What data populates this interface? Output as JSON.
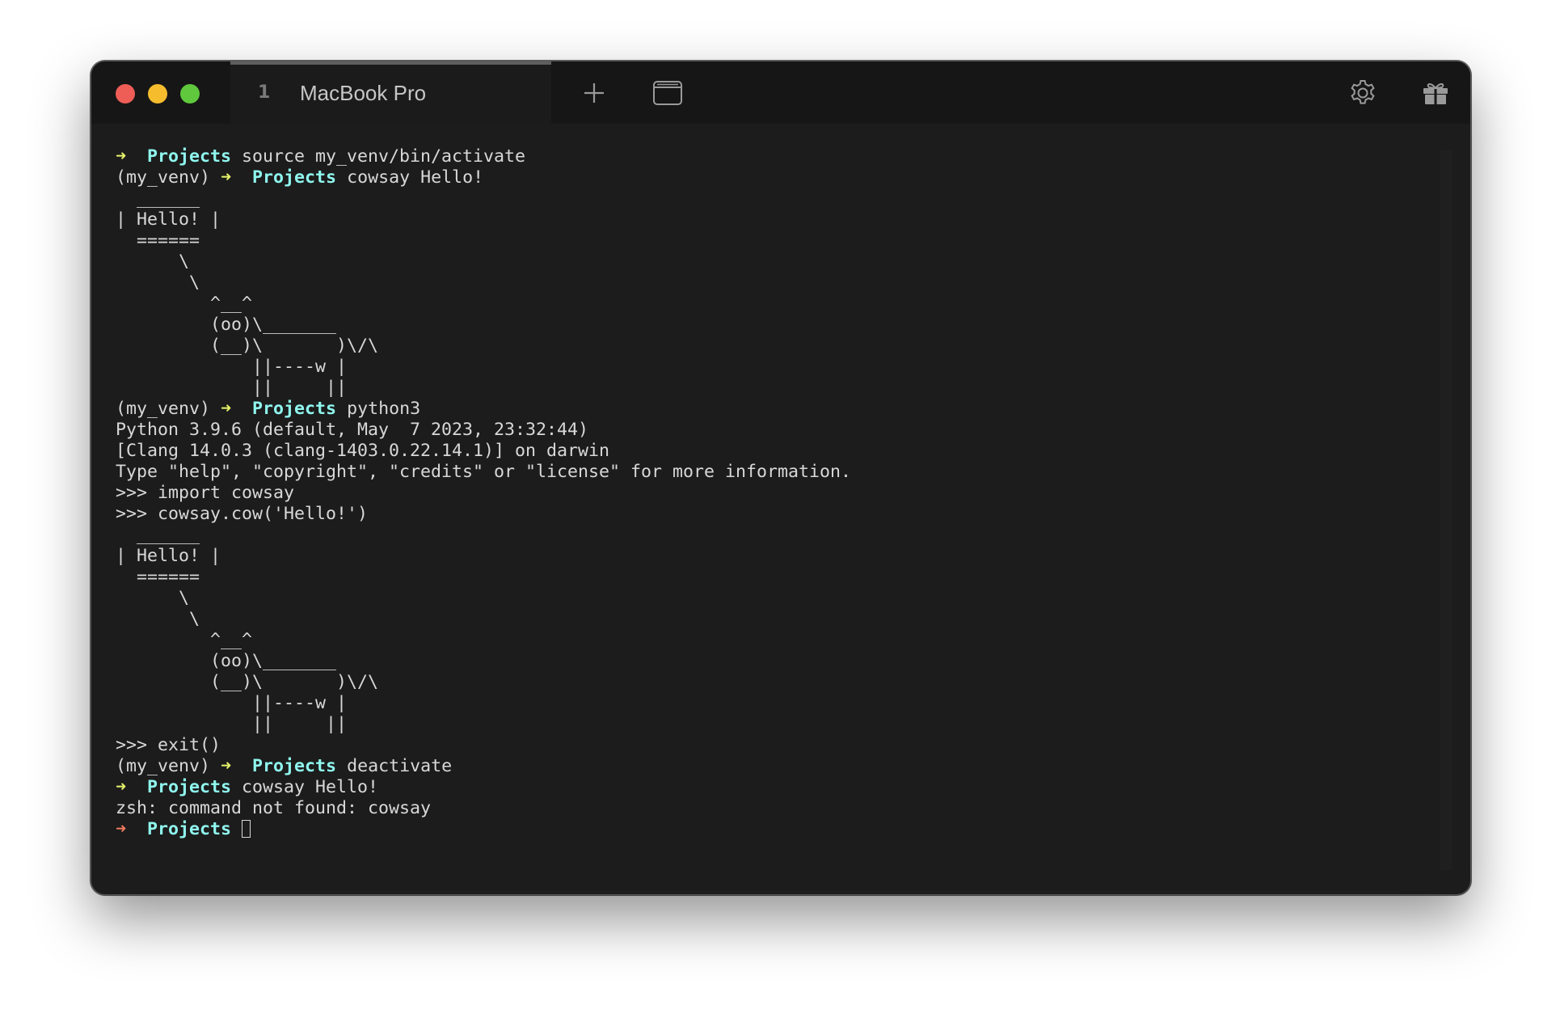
{
  "window": {
    "traffic_lights": [
      {
        "name": "close",
        "color": "#ee5e56"
      },
      {
        "name": "minimize",
        "color": "#f5bd2e"
      },
      {
        "name": "zoom",
        "color": "#5fc83d"
      }
    ]
  },
  "tab": {
    "index": "1",
    "title": "MacBook Pro"
  },
  "toolbar": {
    "new_tab_icon": "plus-icon",
    "window_icon": "window-icon",
    "settings_icon": "gear-icon",
    "gift_icon": "gift-icon"
  },
  "colors": {
    "arrow_ok": "#e6f36a",
    "arrow_err": "#f07a5d",
    "directory": "#8ff7ee",
    "text": "#d8d8d8"
  },
  "terminal": {
    "lines": [
      {
        "type": "prompt",
        "venv": "",
        "arrow": "➜",
        "status": "ok",
        "dir": "Projects",
        "cmd": " source my_venv/bin/activate"
      },
      {
        "type": "prompt",
        "venv": "(my_venv) ",
        "arrow": "➜",
        "status": "ok",
        "dir": "Projects",
        "cmd": " cowsay Hello!"
      },
      {
        "type": "text",
        "text": "  ______"
      },
      {
        "type": "text",
        "text": "| Hello! |"
      },
      {
        "type": "text",
        "text": "  ======"
      },
      {
        "type": "text",
        "text": "      \\"
      },
      {
        "type": "text",
        "text": "       \\"
      },
      {
        "type": "text",
        "text": "         ^__^"
      },
      {
        "type": "text",
        "text": "         (oo)\\_______"
      },
      {
        "type": "text",
        "text": "         (__)\\       )\\/\\"
      },
      {
        "type": "text",
        "text": "             ||----w |"
      },
      {
        "type": "text",
        "text": "             ||     ||"
      },
      {
        "type": "prompt",
        "venv": "(my_venv) ",
        "arrow": "➜",
        "status": "ok",
        "dir": "Projects",
        "cmd": " python3"
      },
      {
        "type": "text",
        "text": "Python 3.9.6 (default, May  7 2023, 23:32:44)"
      },
      {
        "type": "text",
        "text": "[Clang 14.0.3 (clang-1403.0.22.14.1)] on darwin"
      },
      {
        "type": "text",
        "text": "Type \"help\", \"copyright\", \"credits\" or \"license\" for more information."
      },
      {
        "type": "text",
        "text": ">>> import cowsay"
      },
      {
        "type": "text",
        "text": ">>> cowsay.cow('Hello!')"
      },
      {
        "type": "text",
        "text": "  ______"
      },
      {
        "type": "text",
        "text": "| Hello! |"
      },
      {
        "type": "text",
        "text": "  ======"
      },
      {
        "type": "text",
        "text": "      \\"
      },
      {
        "type": "text",
        "text": "       \\"
      },
      {
        "type": "text",
        "text": "         ^__^"
      },
      {
        "type": "text",
        "text": "         (oo)\\_______"
      },
      {
        "type": "text",
        "text": "         (__)\\       )\\/\\"
      },
      {
        "type": "text",
        "text": "             ||----w |"
      },
      {
        "type": "text",
        "text": "             ||     ||"
      },
      {
        "type": "text",
        "text": ">>> exit()"
      },
      {
        "type": "prompt",
        "venv": "(my_venv) ",
        "arrow": "➜",
        "status": "ok",
        "dir": "Projects",
        "cmd": " deactivate"
      },
      {
        "type": "prompt",
        "venv": "",
        "arrow": "➜",
        "status": "ok",
        "dir": "Projects",
        "cmd": " cowsay Hello!"
      },
      {
        "type": "text",
        "text": "zsh: command not found: cowsay"
      },
      {
        "type": "prompt",
        "venv": "",
        "arrow": "➜",
        "status": "err",
        "dir": "Projects",
        "cmd": " ",
        "cursor": true
      }
    ]
  }
}
